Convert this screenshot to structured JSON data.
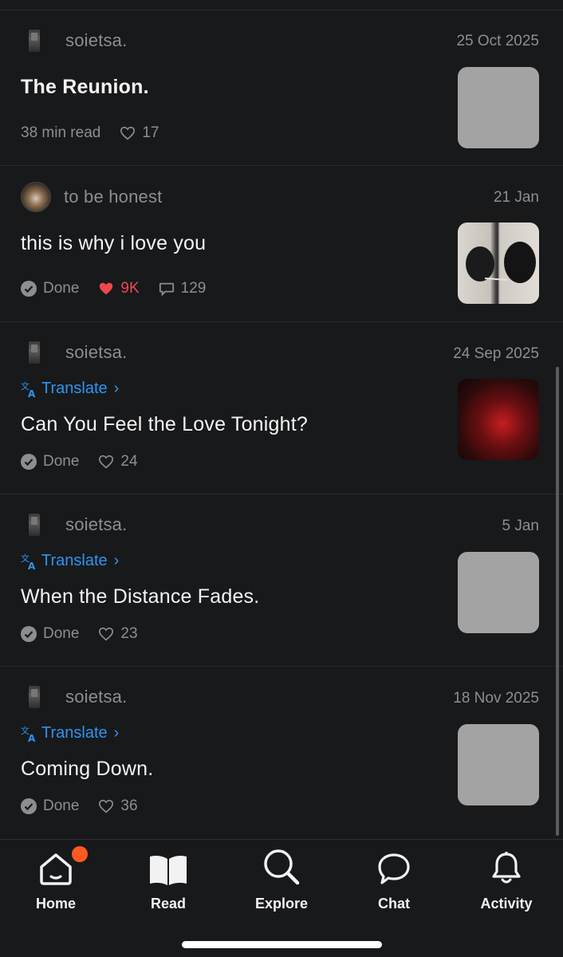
{
  "stories": [
    {
      "author": "soietsa.",
      "date": "25 Oct 2025",
      "title": "The Reunion.",
      "status": "",
      "read_time": "38 min read",
      "likes": "17",
      "comments": "",
      "translate_label": ""
    },
    {
      "author": "to be honest",
      "date": "21 Jan",
      "title": "this is why i love you",
      "status": "Done",
      "likes": "9K",
      "comments": "129",
      "translate_label": ""
    },
    {
      "author": "soietsa.",
      "date": "24 Sep 2025",
      "translate_label": "Translate",
      "title": "Can You Feel the Love Tonight?",
      "status": "Done",
      "likes": "24"
    },
    {
      "author": "soietsa.",
      "date": "5 Jan",
      "translate_label": "Translate",
      "title": "When the Distance Fades.",
      "status": "Done",
      "likes": "23"
    },
    {
      "author": "soietsa.",
      "date": "18 Nov 2025",
      "translate_label": "Translate",
      "title": "Coming Down.",
      "status": "Done",
      "likes": "36"
    }
  ],
  "tabs": [
    {
      "label": "Home",
      "icon": "home-icon",
      "has_badge": true
    },
    {
      "label": "Read",
      "icon": "book-icon"
    },
    {
      "label": "Explore",
      "icon": "search-icon"
    },
    {
      "label": "Chat",
      "icon": "chat-icon"
    },
    {
      "label": "Activity",
      "icon": "bell-icon"
    }
  ],
  "colors": {
    "background": "#18191b",
    "accent_blue": "#2d95f0",
    "like_red": "#f0474f",
    "badge_orange": "#ff5a1f",
    "muted_text": "#8d8e91"
  }
}
